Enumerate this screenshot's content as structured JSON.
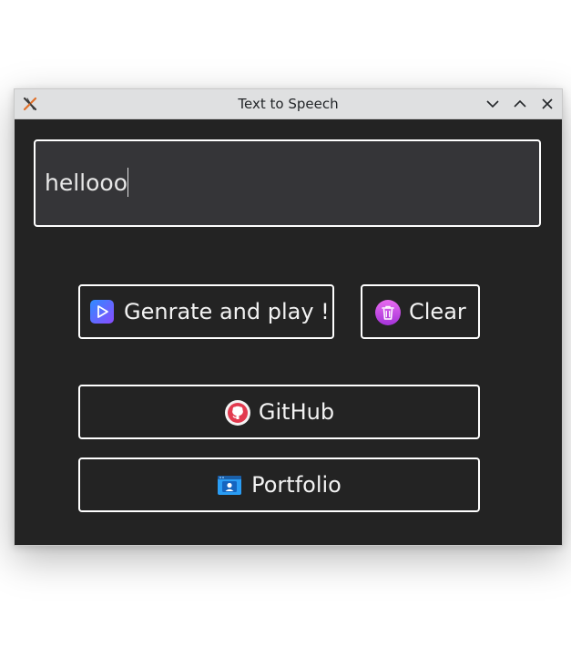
{
  "window": {
    "title": "Text to Speech"
  },
  "titlebar_buttons": {
    "minimize_icon": "chevron-down-icon",
    "maximize_icon": "chevron-up-icon",
    "close_icon": "close-icon"
  },
  "input": {
    "value": "hellooo"
  },
  "buttons": {
    "play_label": "Genrate and play !",
    "clear_label": "Clear",
    "github_label": "GitHub",
    "portfolio_label": "Portfolio"
  },
  "colors": {
    "window_bg": "#232323",
    "input_bg": "#353538",
    "border": "#ffffff",
    "titlebar_bg": "#dfe0e1"
  }
}
